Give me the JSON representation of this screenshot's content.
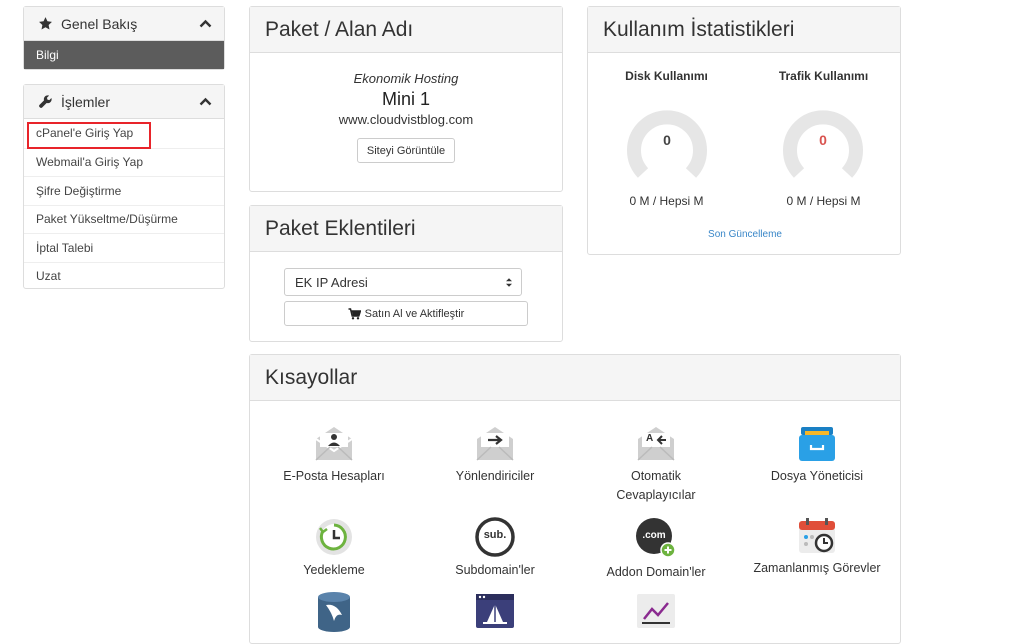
{
  "sidebar": {
    "overview": {
      "title": "Genel Bakış",
      "active_item": "Bilgi"
    },
    "actions": {
      "title": "İşlemler",
      "items": [
        "cPanel'e Giriş Yap",
        "Webmail'a Giriş Yap",
        "Şifre Değiştirme",
        "Paket Yükseltme/Düşürme",
        "İptal Talebi",
        "Uzat"
      ]
    }
  },
  "package": {
    "title": "Paket / Alan Adı",
    "plan_group": "Ekonomik Hosting",
    "plan_name": "Mini 1",
    "domain": "www.cloudvistblog.com",
    "view_site_label": "Siteyi Görüntüle"
  },
  "addons": {
    "title": "Paket Eklentileri",
    "selected_option": "EK IP Adresi",
    "buy_label": "Satın Al ve Aktifleştir"
  },
  "usage": {
    "title": "Kullanım İstatistikleri",
    "disk": {
      "label": "Disk Kullanımı",
      "value": "0",
      "detail": "0 M / Hepsi M"
    },
    "traffic": {
      "label": "Trafik Kullanımı",
      "value": "0",
      "detail": "0 M / Hepsi M"
    },
    "last_update_label": "Son Güncelleme",
    "colors": {
      "disk_value": "#444444",
      "traffic_value": "#d9534f",
      "gauge_track": "#e6e6e6"
    }
  },
  "shortcuts": {
    "title": "Kısayollar",
    "items": [
      {
        "label": "E-Posta Hesapları",
        "icon": "email-accounts-icon"
      },
      {
        "label": "Yönlendiriciler",
        "icon": "forwarders-icon"
      },
      {
        "label": "Otomatik Cevaplayıcılar",
        "icon": "autoresponders-icon"
      },
      {
        "label": "Dosya Yöneticisi",
        "icon": "file-manager-icon"
      },
      {
        "label": "Yedekleme",
        "icon": "backup-icon"
      },
      {
        "label": "Subdomain'ler",
        "icon": "subdomains-icon"
      },
      {
        "label": "Addon Domain'ler",
        "icon": "addon-domains-icon"
      },
      {
        "label": "Zamanlanmış Görevler",
        "icon": "cron-jobs-icon"
      },
      {
        "label": "",
        "icon": "mysql-databases-icon"
      },
      {
        "label": "",
        "icon": "website-builder-icon"
      },
      {
        "label": "",
        "icon": "statistics-icon"
      }
    ],
    "icon_glyphs": {
      "dotcom": ".com",
      "sub": "sub.",
      "autoresponder": "A"
    }
  }
}
